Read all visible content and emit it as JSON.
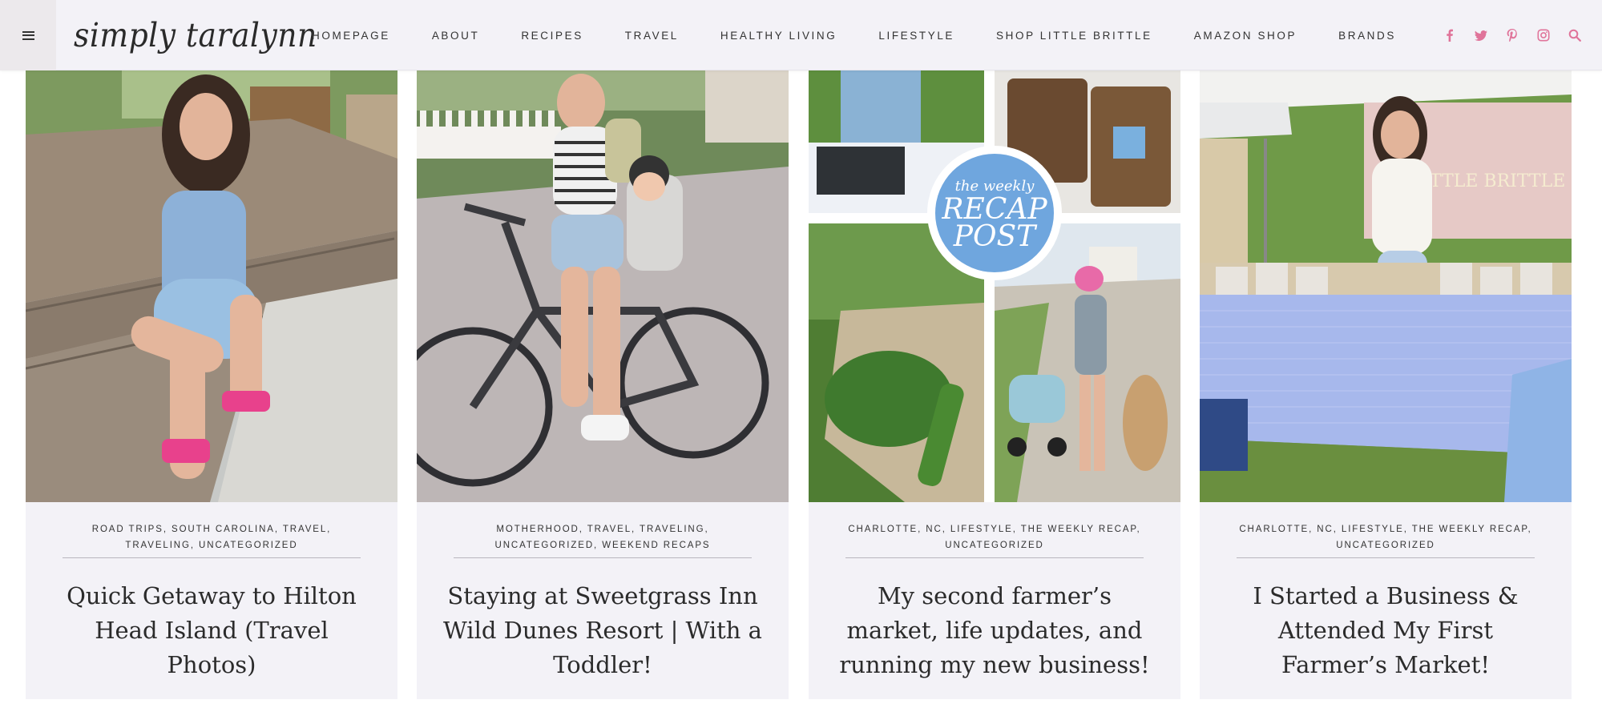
{
  "header": {
    "logo_text": "simply taralynn",
    "nav_items": [
      "HOMEPAGE",
      "ABOUT",
      "RECIPES",
      "TRAVEL",
      "HEALTHY LIVING",
      "LIFESTYLE",
      "SHOP LITTLE BRITTLE",
      "AMAZON SHOP",
      "BRANDS"
    ],
    "socials": [
      "facebook-icon",
      "twitter-icon",
      "pinterest-icon",
      "instagram-icon",
      "search-icon"
    ],
    "accent_color": "#e0749a"
  },
  "posts": [
    {
      "categories": [
        "ROAD TRIPS",
        "SOUTH CAROLINA",
        "TRAVEL",
        "TRAVELING",
        "UNCATEGORIZED"
      ],
      "title": "Quick Getaway to Hilton Head Island (Travel Photos)"
    },
    {
      "categories": [
        "MOTHERHOOD",
        "TRAVEL",
        "TRAVELING",
        "UNCATEGORIZED",
        "WEEKEND RECAPS"
      ],
      "title": "Staying at Sweetgrass Inn Wild Dunes Resort | With a Toddler!"
    },
    {
      "categories": [
        "CHARLOTTE, NC",
        "LIFESTYLE",
        "THE WEEKLY RECAP",
        "UNCATEGORIZED"
      ],
      "title": "My second farmer’s market, life updates, and running my new business!",
      "badge": {
        "script": "the weekly",
        "line1": "RECAP",
        "line2": "POST"
      }
    },
    {
      "categories": [
        "CHARLOTTE, NC",
        "LIFESTYLE",
        "THE WEEKLY RECAP",
        "UNCATEGORIZED"
      ],
      "title": "I Started a Business & Attended My First Farmer’s Market!",
      "banner_text": "LITTLE BRITTLE"
    }
  ]
}
